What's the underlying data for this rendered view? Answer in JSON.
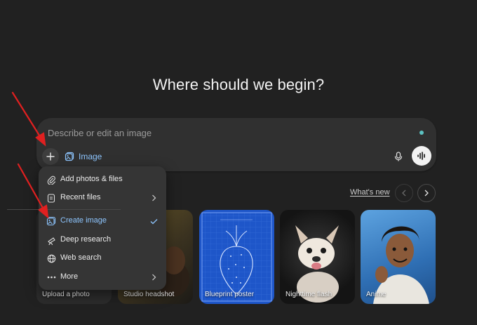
{
  "heading": "Where should we begin?",
  "composer": {
    "placeholder": "Describe or edit an image",
    "chip_label": "Image",
    "icons": {
      "plus": "plus-icon",
      "image": "image-icon",
      "mic": "microphone-icon",
      "voice": "voice-waveform-icon"
    }
  },
  "colors": {
    "background": "#212121",
    "composer": "#303030",
    "menu": "#353535",
    "accent": "#8ec6ff",
    "status_dot": "#5cc2c2",
    "arrow": "#e02020"
  },
  "menu": {
    "items": [
      {
        "label": "Add photos & files",
        "icon": "paperclip-icon"
      },
      {
        "label": "Recent files",
        "icon": "file-icon",
        "trailing": "chevron-right-icon"
      },
      {
        "label": "Create image",
        "icon": "image-icon",
        "trailing": "check-icon",
        "selected": true
      },
      {
        "label": "Deep research",
        "icon": "telescope-icon"
      },
      {
        "label": "Web search",
        "icon": "globe-icon"
      },
      {
        "label": "More",
        "icon": "more-dots-icon",
        "trailing": "chevron-right-icon"
      }
    ]
  },
  "whats_new": "What's new",
  "cards": [
    {
      "label": "Upload a photo"
    },
    {
      "label": "Studio headshot"
    },
    {
      "label": "Blueprint poster"
    },
    {
      "label": "Nighttime flash"
    },
    {
      "label": "Anime"
    }
  ]
}
